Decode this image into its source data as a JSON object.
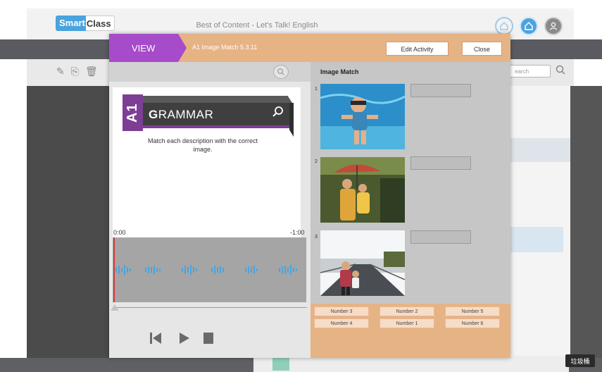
{
  "app": {
    "logo_part1": "Smart",
    "logo_part2": "Class",
    "title": "Best of Content - Let's Talk! English",
    "search_placeholder": "earch",
    "trash_label": "垃圾桶"
  },
  "modal": {
    "view_label": "VIEW",
    "activity_name": "A1 Image Match 5.3.11",
    "edit_button": "Edit Activity",
    "close_button": "Close"
  },
  "media": {
    "badge": "A1",
    "heading_initial": "G",
    "heading_rest": "RAMMAR",
    "instruction": "Match each description with the correct image.",
    "time_start": "0:00",
    "time_end": "-1:00"
  },
  "activity": {
    "title": "Image Match",
    "questions": [
      {
        "number": "1",
        "image": "child-swimming-underwater"
      },
      {
        "number": "2",
        "image": "mother-and-child-with-umbrella"
      },
      {
        "number": "3",
        "image": "woman-and-child-on-boardwalk"
      }
    ],
    "choices": [
      "Number 3",
      "Number 2",
      "Number 5",
      "Number 4",
      "Number 1",
      "Number 6"
    ]
  },
  "colors": {
    "accent_purple": "#a64bc9",
    "accent_orange": "#e6b385",
    "waveform_blue": "#4aa3df"
  },
  "icons": [
    "home-outline-icon",
    "home-icon",
    "user-icon",
    "pencil-icon",
    "copy-icon",
    "trash-icon",
    "zoom-icon",
    "search-icon",
    "skip-back-icon",
    "play-icon",
    "stop-icon"
  ]
}
